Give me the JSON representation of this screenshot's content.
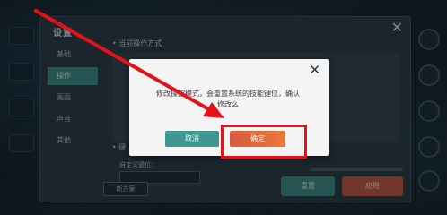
{
  "settings": {
    "logo_text": "设置",
    "close_glyph": "✕",
    "nav_items": [
      {
        "label": "基础"
      },
      {
        "label": "操作"
      },
      {
        "label": "画面"
      },
      {
        "label": "声音"
      },
      {
        "label": "其他"
      }
    ],
    "content_header": "• 当前操作方式",
    "section2_header": "• 键",
    "custom_label": "自定义键位：",
    "bottom_tag": "新方案",
    "reset_label": "重置",
    "apply_label": "应用"
  },
  "dialog": {
    "close_glyph": "✕",
    "message": "修改操控模式，会重置系统的技能键位，确认修改么",
    "cancel_label": "取消",
    "confirm_label": "确定"
  },
  "annotation": {
    "arrow_color": "#e3121a",
    "box_color": "#e3121a"
  }
}
